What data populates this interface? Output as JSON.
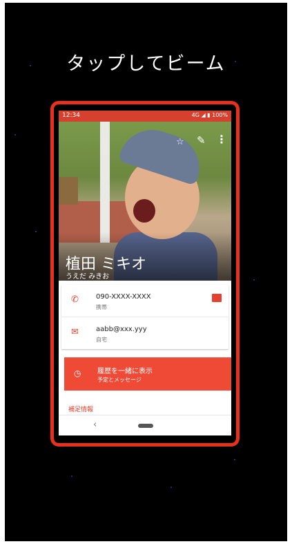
{
  "screen_title": "タップしてビーム",
  "status_bar": {
    "time": "12:34",
    "indicators": "4G ◢ ▮ 100%"
  },
  "contact": {
    "name": "植田 ミキオ",
    "yomi": "うえだ みきお",
    "phone": {
      "number": "090-XXXX-XXXX",
      "type": "携帯"
    },
    "email": {
      "address": "aabb@xxx.yyy",
      "type": "自宅"
    },
    "history": {
      "title": "履歴を一緒に表示",
      "subtitle": "予定とメッセージ"
    },
    "extra_info_label": "補足情報"
  },
  "icons": {
    "star": "☆",
    "edit": "✎",
    "more": "⋮",
    "phone": "✆",
    "email": "✉",
    "history": "◷",
    "back": "‹"
  },
  "colors": {
    "accent": "#e5412f",
    "status_bar": "#d6402e",
    "frame_border": "#e8311c",
    "background": "#000000"
  }
}
